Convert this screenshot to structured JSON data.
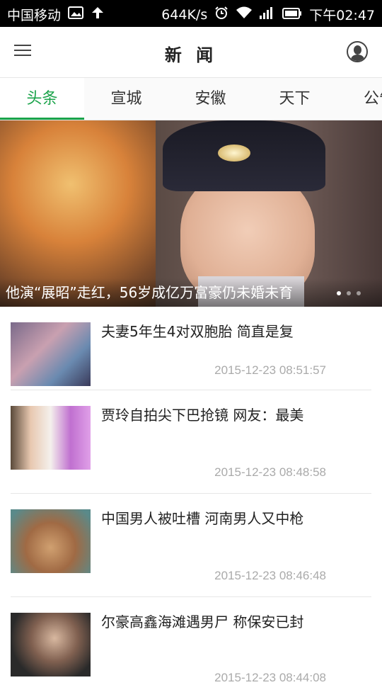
{
  "status_bar": {
    "carrier": "中国移动",
    "speed": "644K/s",
    "time": "下午02:47"
  },
  "app_bar": {
    "title": "新 闻"
  },
  "tabs": [
    {
      "label": "头条",
      "active": true
    },
    {
      "label": "宣城",
      "active": false
    },
    {
      "label": "安徽",
      "active": false
    },
    {
      "label": "天下",
      "active": false
    },
    {
      "label": "公告",
      "active": false
    }
  ],
  "hero": {
    "caption": "他演“展昭”走红，56岁成亿万富豪仍未婚未育"
  },
  "news": [
    {
      "title": "夫妻5年生4对双胞胎 简直是复",
      "time": "2015-12-23 08:51:57"
    },
    {
      "title": "贾玲自拍尖下巴抢镜 网友：最美",
      "time": "2015-12-23 08:48:58"
    },
    {
      "title": "中国男人被吐槽 河南男人又中枪",
      "time": "2015-12-23 08:46:48"
    },
    {
      "title": "尔豪高鑫海滩遇男尸 称保安已封",
      "time": "2015-12-23 08:44:08"
    }
  ],
  "colors": {
    "accent": "#1aa34a",
    "status_bar": "#000000"
  }
}
